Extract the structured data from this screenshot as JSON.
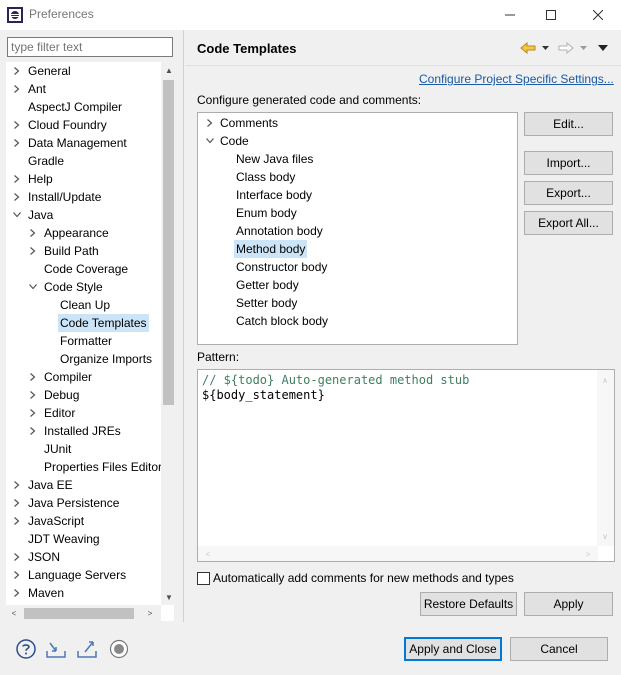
{
  "window": {
    "title": "Preferences"
  },
  "filter": {
    "placeholder": "type filter text"
  },
  "tree": [
    {
      "label": "General"
    },
    {
      "label": "Ant"
    },
    {
      "label": "AspectJ Compiler"
    },
    {
      "label": "Cloud Foundry"
    },
    {
      "label": "Data Management"
    },
    {
      "label": "Gradle"
    },
    {
      "label": "Help"
    },
    {
      "label": "Install/Update"
    },
    {
      "label": "Java"
    },
    {
      "label": "Appearance"
    },
    {
      "label": "Build Path"
    },
    {
      "label": "Code Coverage"
    },
    {
      "label": "Code Style"
    },
    {
      "label": "Clean Up"
    },
    {
      "label": "Code Templates"
    },
    {
      "label": "Formatter"
    },
    {
      "label": "Organize Imports"
    },
    {
      "label": "Compiler"
    },
    {
      "label": "Debug"
    },
    {
      "label": "Editor"
    },
    {
      "label": "Installed JREs"
    },
    {
      "label": "JUnit"
    },
    {
      "label": "Properties Files Editor"
    },
    {
      "label": "Java EE"
    },
    {
      "label": "Java Persistence"
    },
    {
      "label": "JavaScript"
    },
    {
      "label": "JDT Weaving"
    },
    {
      "label": "JSON"
    },
    {
      "label": "Language Servers"
    },
    {
      "label": "Maven"
    }
  ],
  "page": {
    "title": "Code Templates",
    "project_link": "Configure Project Specific Settings...",
    "configure_label": "Configure generated code and comments:",
    "pattern_label": "Pattern:",
    "auto_comment_label": "Automatically add comments for new methods and types"
  },
  "templates": [
    {
      "label": "Comments"
    },
    {
      "label": "Code"
    },
    {
      "label": "New Java files"
    },
    {
      "label": "Class body"
    },
    {
      "label": "Interface body"
    },
    {
      "label": "Enum body"
    },
    {
      "label": "Annotation body"
    },
    {
      "label": "Method body"
    },
    {
      "label": "Constructor body"
    },
    {
      "label": "Getter body"
    },
    {
      "label": "Setter body"
    },
    {
      "label": "Catch block body"
    }
  ],
  "pattern": {
    "lines": [
      "// ${todo} Auto-generated method stub",
      "${body_statement}"
    ]
  },
  "buttons": {
    "edit": "Edit...",
    "import": "Import...",
    "export": "Export...",
    "export_all": "Export All...",
    "restore_defaults": "Restore Defaults",
    "apply": "Apply",
    "apply_close": "Apply and Close",
    "cancel": "Cancel"
  },
  "colors": {
    "selection": "#cce4f7",
    "link": "#1a5aa6",
    "comment": "#3f7f5f",
    "primary_border": "#0078d7"
  }
}
